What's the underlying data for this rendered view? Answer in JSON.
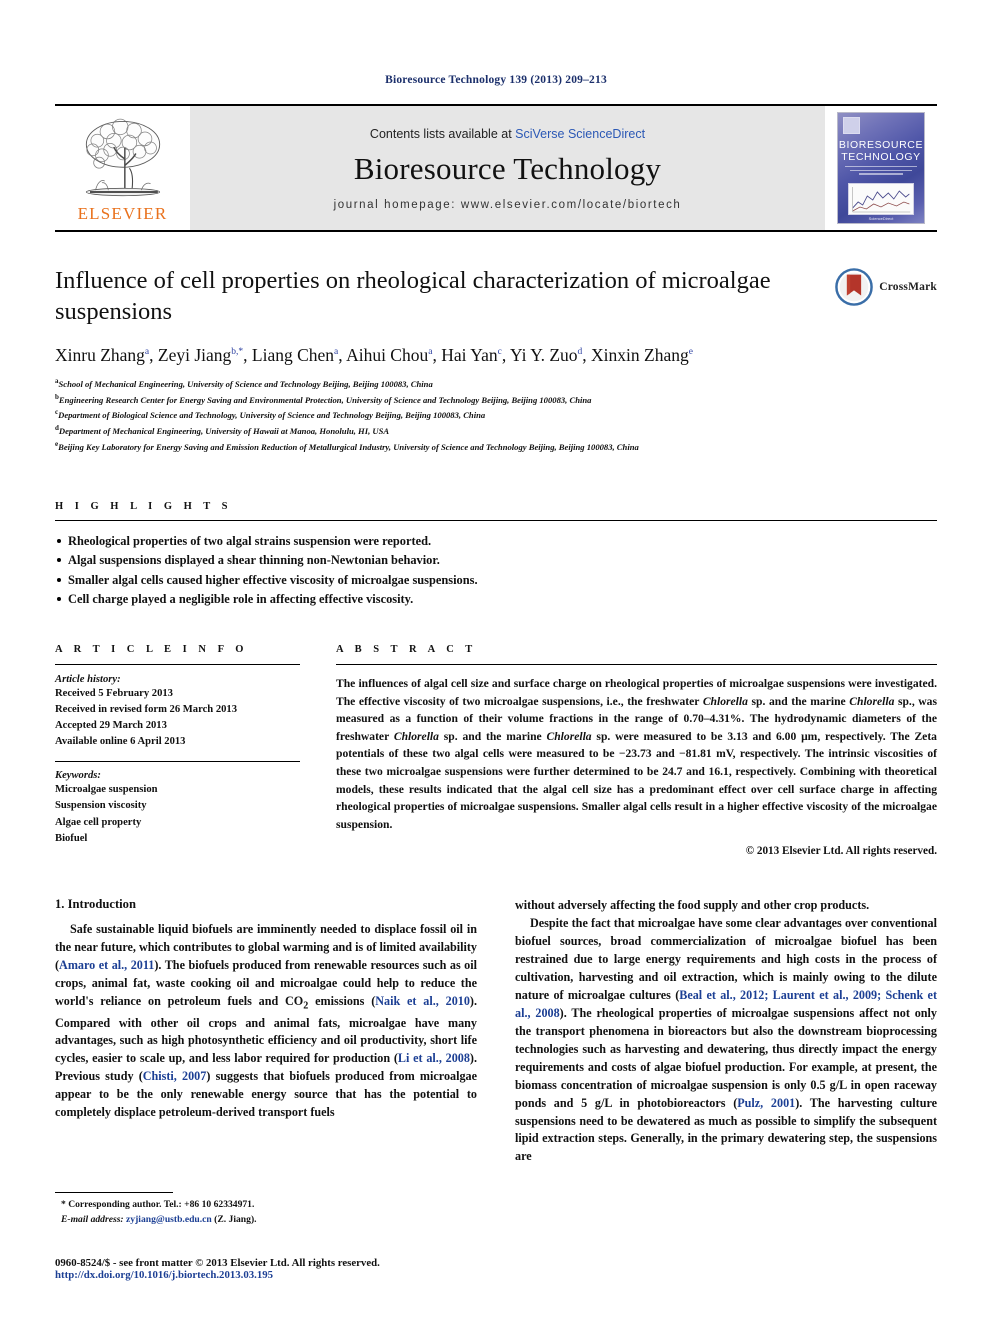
{
  "running_head": "Bioresource Technology 139 (2013) 209–213",
  "masthead": {
    "contents_prefix": "Contents lists available at ",
    "contents_link": "SciVerse ScienceDirect",
    "journal_name": "Bioresource Technology",
    "homepage": "journal homepage: www.elsevier.com/locate/biortech",
    "publisher_wordmark": "ELSEVIER",
    "cover_title_line1": "BIORESOURCE",
    "cover_title_line2": "TECHNOLOGY",
    "cover_footer": "ScienceDirect",
    "accent_link_color": "#2b58b5",
    "elsevier_orange": "#e9711c"
  },
  "article": {
    "title": "Influence of cell properties on rheological characterization of microalgae suspensions",
    "crossmark_label": "CrossMark",
    "authors": [
      {
        "name": "Xinru Zhang",
        "sup": "a"
      },
      {
        "name": "Zeyi Jiang",
        "sup": "b,*"
      },
      {
        "name": "Liang Chen",
        "sup": "a"
      },
      {
        "name": "Aihui Chou",
        "sup": "a"
      },
      {
        "name": "Hai Yan",
        "sup": "c"
      },
      {
        "name": "Yi Y. Zuo",
        "sup": "d"
      },
      {
        "name": "Xinxin Zhang",
        "sup": "e"
      }
    ],
    "affiliations": [
      {
        "mark": "a",
        "text": "School of Mechanical Engineering, University of Science and Technology Beijing, Beijing 100083, China"
      },
      {
        "mark": "b",
        "text": "Engineering Research Center for Energy Saving and Environmental Protection, University of Science and Technology Beijing, Beijing 100083, China"
      },
      {
        "mark": "c",
        "text": "Department of Biological Science and Technology, University of Science and Technology Beijing, Beijing 100083, China"
      },
      {
        "mark": "d",
        "text": "Department of Mechanical Engineering, University of Hawaii at Manoa, Honolulu, HI, USA"
      },
      {
        "mark": "e",
        "text": "Beijing Key Laboratory for Energy Saving and Emission Reduction of Metallurgical Industry, University of Science and Technology Beijing, Beijing 100083, China"
      }
    ]
  },
  "highlights": {
    "heading": "H I G H L I G H T S",
    "items": [
      "Rheological properties of two algal strains suspension were reported.",
      "Algal suspensions displayed a shear thinning non-Newtonian behavior.",
      "Smaller algal cells caused higher effective viscosity of microalgae suspensions.",
      "Cell charge played a negligible role in affecting effective viscosity."
    ]
  },
  "article_info": {
    "heading": "A R T I C L E    I N F O",
    "history_label": "Article history:",
    "history": [
      "Received 5 February 2013",
      "Received in revised form 26 March 2013",
      "Accepted 29 March 2013",
      "Available online 6 April 2013"
    ],
    "keywords_label": "Keywords:",
    "keywords": [
      "Microalgae suspension",
      "Suspension viscosity",
      "Algae cell property",
      "Biofuel"
    ]
  },
  "abstract": {
    "heading": "A B S T R A C T",
    "paragraph_1": "The influences of algal cell size and surface charge on rheological properties of microalgae suspensions were investigated. The effective viscosity of two microalgae suspensions, i.e., the freshwater ",
    "italic_1": "Chlorella",
    "paragraph_2": " sp. and the marine ",
    "italic_2": "Chlorella",
    "paragraph_3": " sp., was measured as a function of their volume fractions in the range of 0.70–4.31%. The hydrodynamic diameters of the freshwater ",
    "italic_3": "Chlorella",
    "paragraph_4": " sp. and the marine ",
    "italic_4": "Chlorella",
    "paragraph_5": " sp. were measured to be 3.13 and 6.00 μm, respectively. The Zeta potentials of these two algal cells were measured to be −23.73 and −81.81 mV, respectively. The intrinsic viscosities of these two microalgae suspensions were further determined to be 24.7 and 16.1, respectively. Combining with theoretical models, these results indicated that the algal cell size has a predominant effect over cell surface charge in affecting rheological properties of microalgae suspensions. Smaller algal cells result in a higher effective viscosity of the microalgae suspension.",
    "copyright": "© 2013 Elsevier Ltd. All rights reserved."
  },
  "body": {
    "section_heading": "1. Introduction",
    "left_paragraphs": [
      {
        "runs": [
          {
            "t": "Safe sustainable liquid biofuels are imminently needed to displace fossil oil in the near future, which contributes to global warming and is of limited availability ("
          },
          {
            "t": "Amaro et al., 2011",
            "cite": true
          },
          {
            "t": "). The biofuels produced from renewable resources such as oil crops, animal fat, waste cooking oil and microalgae could help to reduce the world's reliance on petroleum fuels and CO"
          },
          {
            "t": "2",
            "sub": true
          },
          {
            "t": " emissions ("
          },
          {
            "t": "Naik et al., 2010",
            "cite": true
          },
          {
            "t": "). Compared with other oil crops and animal fats, microalgae have many advantages, such as high photosynthetic efficiency and oil productivity, short life cycles, easier to scale up, and less labor required for production ("
          },
          {
            "t": "Li et al., 2008",
            "cite": true
          },
          {
            "t": "). Previous study ("
          },
          {
            "t": "Chisti, 2007",
            "cite": true
          },
          {
            "t": ") suggests that biofuels produced from microalgae appear to be the only renewable energy source that has the potential to completely displace petroleum-derived transport fuels"
          }
        ]
      }
    ],
    "right_paragraphs": [
      {
        "no_indent": true,
        "runs": [
          {
            "t": "without adversely affecting the food supply and other crop products."
          }
        ]
      },
      {
        "runs": [
          {
            "t": "Despite the fact that microalgae have some clear advantages over conventional biofuel sources, broad commercialization of microalgae biofuel has been restrained due to large energy requirements and high costs in the process of cultivation, harvesting and oil extraction, which is mainly owing to the dilute nature of microalgae cultures ("
          },
          {
            "t": "Beal et al., 2012; Laurent et al., 2009; Schenk et al., 2008",
            "cite": true
          },
          {
            "t": "). The rheological properties of microalgae suspensions affect not only the transport phenomena in bioreactors but also the downstream bioprocessing technologies such as harvesting and dewatering, thus directly impact the energy requirements and costs of algae biofuel production. For example, at present, the biomass concentration of microalgae suspension is only 0.5 g/L in open raceway ponds and 5 g/L in photobioreactors ("
          },
          {
            "t": "Pulz, 2001",
            "cite": true
          },
          {
            "t": "). The harvesting culture suspensions need to be dewatered as much as possible to simplify the subsequent lipid extraction steps. Generally, in the primary dewatering step, the suspensions are"
          }
        ]
      }
    ]
  },
  "footnotes": {
    "corresponding": "* Corresponding author. Tel.: +86 10 62334971.",
    "email_label": "E-mail address:",
    "email": "zyjiang@ustb.edu.cn",
    "email_suffix": "(Z. Jiang)."
  },
  "footer": {
    "issn_line": "0960-8524/$ - see front matter © 2013 Elsevier Ltd. All rights reserved.",
    "doi": "http://dx.doi.org/10.1016/j.biortech.2013.03.195"
  }
}
